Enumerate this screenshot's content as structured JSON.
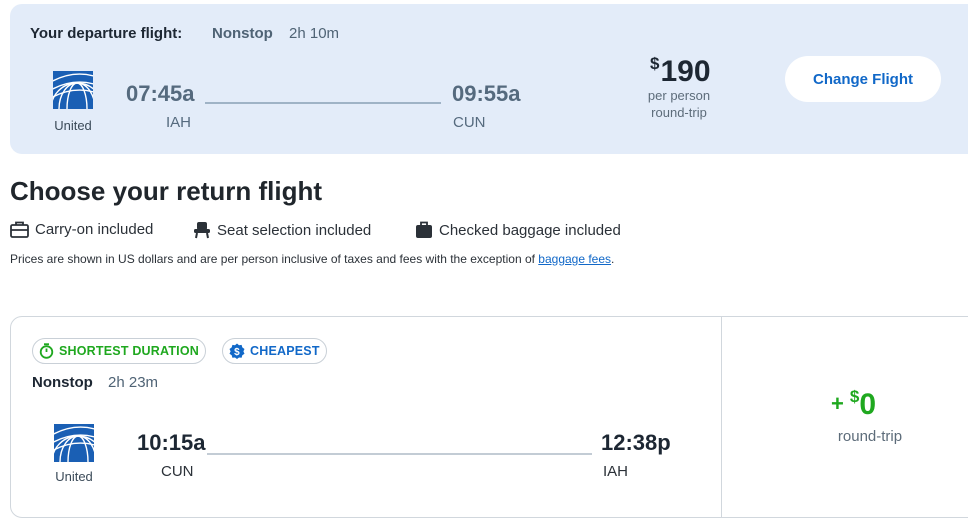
{
  "departure": {
    "title": "Your departure flight:",
    "stops": "Nonstop",
    "duration": "2h 10m",
    "airline": "United",
    "depart_time": "07:45a",
    "depart_code": "IAH",
    "arrive_time": "09:55a",
    "arrive_code": "CUN",
    "price_currency": "$",
    "price_value": "190",
    "price_sub1": "per person",
    "price_sub2": "round-trip",
    "change_label": "Change Flight"
  },
  "return_section": {
    "title": "Choose your return flight",
    "features": [
      {
        "icon": "carry-on-bag-icon",
        "label": "Carry-on included"
      },
      {
        "icon": "seat-icon",
        "label": "Seat selection included"
      },
      {
        "icon": "checked-bag-icon",
        "label": "Checked baggage included"
      }
    ],
    "note_text": "Prices are shown in US dollars and are per person inclusive of taxes and fees with the exception of ",
    "note_link": "baggage fees",
    "note_end": "."
  },
  "result": {
    "badges": [
      {
        "label": "SHORTEST DURATION",
        "icon": "stopwatch-icon",
        "color": "#1fa81f"
      },
      {
        "label": "CHEAPEST",
        "icon": "dollar-badge-icon",
        "color": "#1168c8"
      }
    ],
    "stops": "Nonstop",
    "duration": "2h 23m",
    "airline": "United",
    "depart_time": "10:15a",
    "depart_code": "CUN",
    "arrive_time": "12:38p",
    "arrive_code": "IAH",
    "price_prefix": "+",
    "price_currency": "$",
    "price_value": "0",
    "price_label": "round-trip"
  },
  "colors": {
    "banner_bg": "#e3ecf9",
    "accent_blue": "#1168c8",
    "price_green": "#1fa81f"
  }
}
